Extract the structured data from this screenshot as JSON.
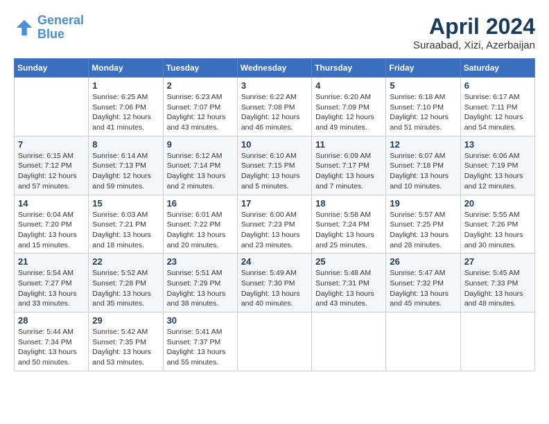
{
  "header": {
    "logo_line1": "General",
    "logo_line2": "Blue",
    "month_year": "April 2024",
    "location": "Suraabad, Xizi, Azerbaijan"
  },
  "weekdays": [
    "Sunday",
    "Monday",
    "Tuesday",
    "Wednesday",
    "Thursday",
    "Friday",
    "Saturday"
  ],
  "weeks": [
    [
      {
        "day": "",
        "info": ""
      },
      {
        "day": "1",
        "info": "Sunrise: 6:25 AM\nSunset: 7:06 PM\nDaylight: 12 hours\nand 41 minutes."
      },
      {
        "day": "2",
        "info": "Sunrise: 6:23 AM\nSunset: 7:07 PM\nDaylight: 12 hours\nand 43 minutes."
      },
      {
        "day": "3",
        "info": "Sunrise: 6:22 AM\nSunset: 7:08 PM\nDaylight: 12 hours\nand 46 minutes."
      },
      {
        "day": "4",
        "info": "Sunrise: 6:20 AM\nSunset: 7:09 PM\nDaylight: 12 hours\nand 49 minutes."
      },
      {
        "day": "5",
        "info": "Sunrise: 6:18 AM\nSunset: 7:10 PM\nDaylight: 12 hours\nand 51 minutes."
      },
      {
        "day": "6",
        "info": "Sunrise: 6:17 AM\nSunset: 7:11 PM\nDaylight: 12 hours\nand 54 minutes."
      }
    ],
    [
      {
        "day": "7",
        "info": "Sunrise: 6:15 AM\nSunset: 7:12 PM\nDaylight: 12 hours\nand 57 minutes."
      },
      {
        "day": "8",
        "info": "Sunrise: 6:14 AM\nSunset: 7:13 PM\nDaylight: 12 hours\nand 59 minutes."
      },
      {
        "day": "9",
        "info": "Sunrise: 6:12 AM\nSunset: 7:14 PM\nDaylight: 13 hours\nand 2 minutes."
      },
      {
        "day": "10",
        "info": "Sunrise: 6:10 AM\nSunset: 7:15 PM\nDaylight: 13 hours\nand 5 minutes."
      },
      {
        "day": "11",
        "info": "Sunrise: 6:09 AM\nSunset: 7:17 PM\nDaylight: 13 hours\nand 7 minutes."
      },
      {
        "day": "12",
        "info": "Sunrise: 6:07 AM\nSunset: 7:18 PM\nDaylight: 13 hours\nand 10 minutes."
      },
      {
        "day": "13",
        "info": "Sunrise: 6:06 AM\nSunset: 7:19 PM\nDaylight: 13 hours\nand 12 minutes."
      }
    ],
    [
      {
        "day": "14",
        "info": "Sunrise: 6:04 AM\nSunset: 7:20 PM\nDaylight: 13 hours\nand 15 minutes."
      },
      {
        "day": "15",
        "info": "Sunrise: 6:03 AM\nSunset: 7:21 PM\nDaylight: 13 hours\nand 18 minutes."
      },
      {
        "day": "16",
        "info": "Sunrise: 6:01 AM\nSunset: 7:22 PM\nDaylight: 13 hours\nand 20 minutes."
      },
      {
        "day": "17",
        "info": "Sunrise: 6:00 AM\nSunset: 7:23 PM\nDaylight: 13 hours\nand 23 minutes."
      },
      {
        "day": "18",
        "info": "Sunrise: 5:58 AM\nSunset: 7:24 PM\nDaylight: 13 hours\nand 25 minutes."
      },
      {
        "day": "19",
        "info": "Sunrise: 5:57 AM\nSunset: 7:25 PM\nDaylight: 13 hours\nand 28 minutes."
      },
      {
        "day": "20",
        "info": "Sunrise: 5:55 AM\nSunset: 7:26 PM\nDaylight: 13 hours\nand 30 minutes."
      }
    ],
    [
      {
        "day": "21",
        "info": "Sunrise: 5:54 AM\nSunset: 7:27 PM\nDaylight: 13 hours\nand 33 minutes."
      },
      {
        "day": "22",
        "info": "Sunrise: 5:52 AM\nSunset: 7:28 PM\nDaylight: 13 hours\nand 35 minutes."
      },
      {
        "day": "23",
        "info": "Sunrise: 5:51 AM\nSunset: 7:29 PM\nDaylight: 13 hours\nand 38 minutes."
      },
      {
        "day": "24",
        "info": "Sunrise: 5:49 AM\nSunset: 7:30 PM\nDaylight: 13 hours\nand 40 minutes."
      },
      {
        "day": "25",
        "info": "Sunrise: 5:48 AM\nSunset: 7:31 PM\nDaylight: 13 hours\nand 43 minutes."
      },
      {
        "day": "26",
        "info": "Sunrise: 5:47 AM\nSunset: 7:32 PM\nDaylight: 13 hours\nand 45 minutes."
      },
      {
        "day": "27",
        "info": "Sunrise: 5:45 AM\nSunset: 7:33 PM\nDaylight: 13 hours\nand 48 minutes."
      }
    ],
    [
      {
        "day": "28",
        "info": "Sunrise: 5:44 AM\nSunset: 7:34 PM\nDaylight: 13 hours\nand 50 minutes."
      },
      {
        "day": "29",
        "info": "Sunrise: 5:42 AM\nSunset: 7:35 PM\nDaylight: 13 hours\nand 53 minutes."
      },
      {
        "day": "30",
        "info": "Sunrise: 5:41 AM\nSunset: 7:37 PM\nDaylight: 13 hours\nand 55 minutes."
      },
      {
        "day": "",
        "info": ""
      },
      {
        "day": "",
        "info": ""
      },
      {
        "day": "",
        "info": ""
      },
      {
        "day": "",
        "info": ""
      }
    ]
  ]
}
